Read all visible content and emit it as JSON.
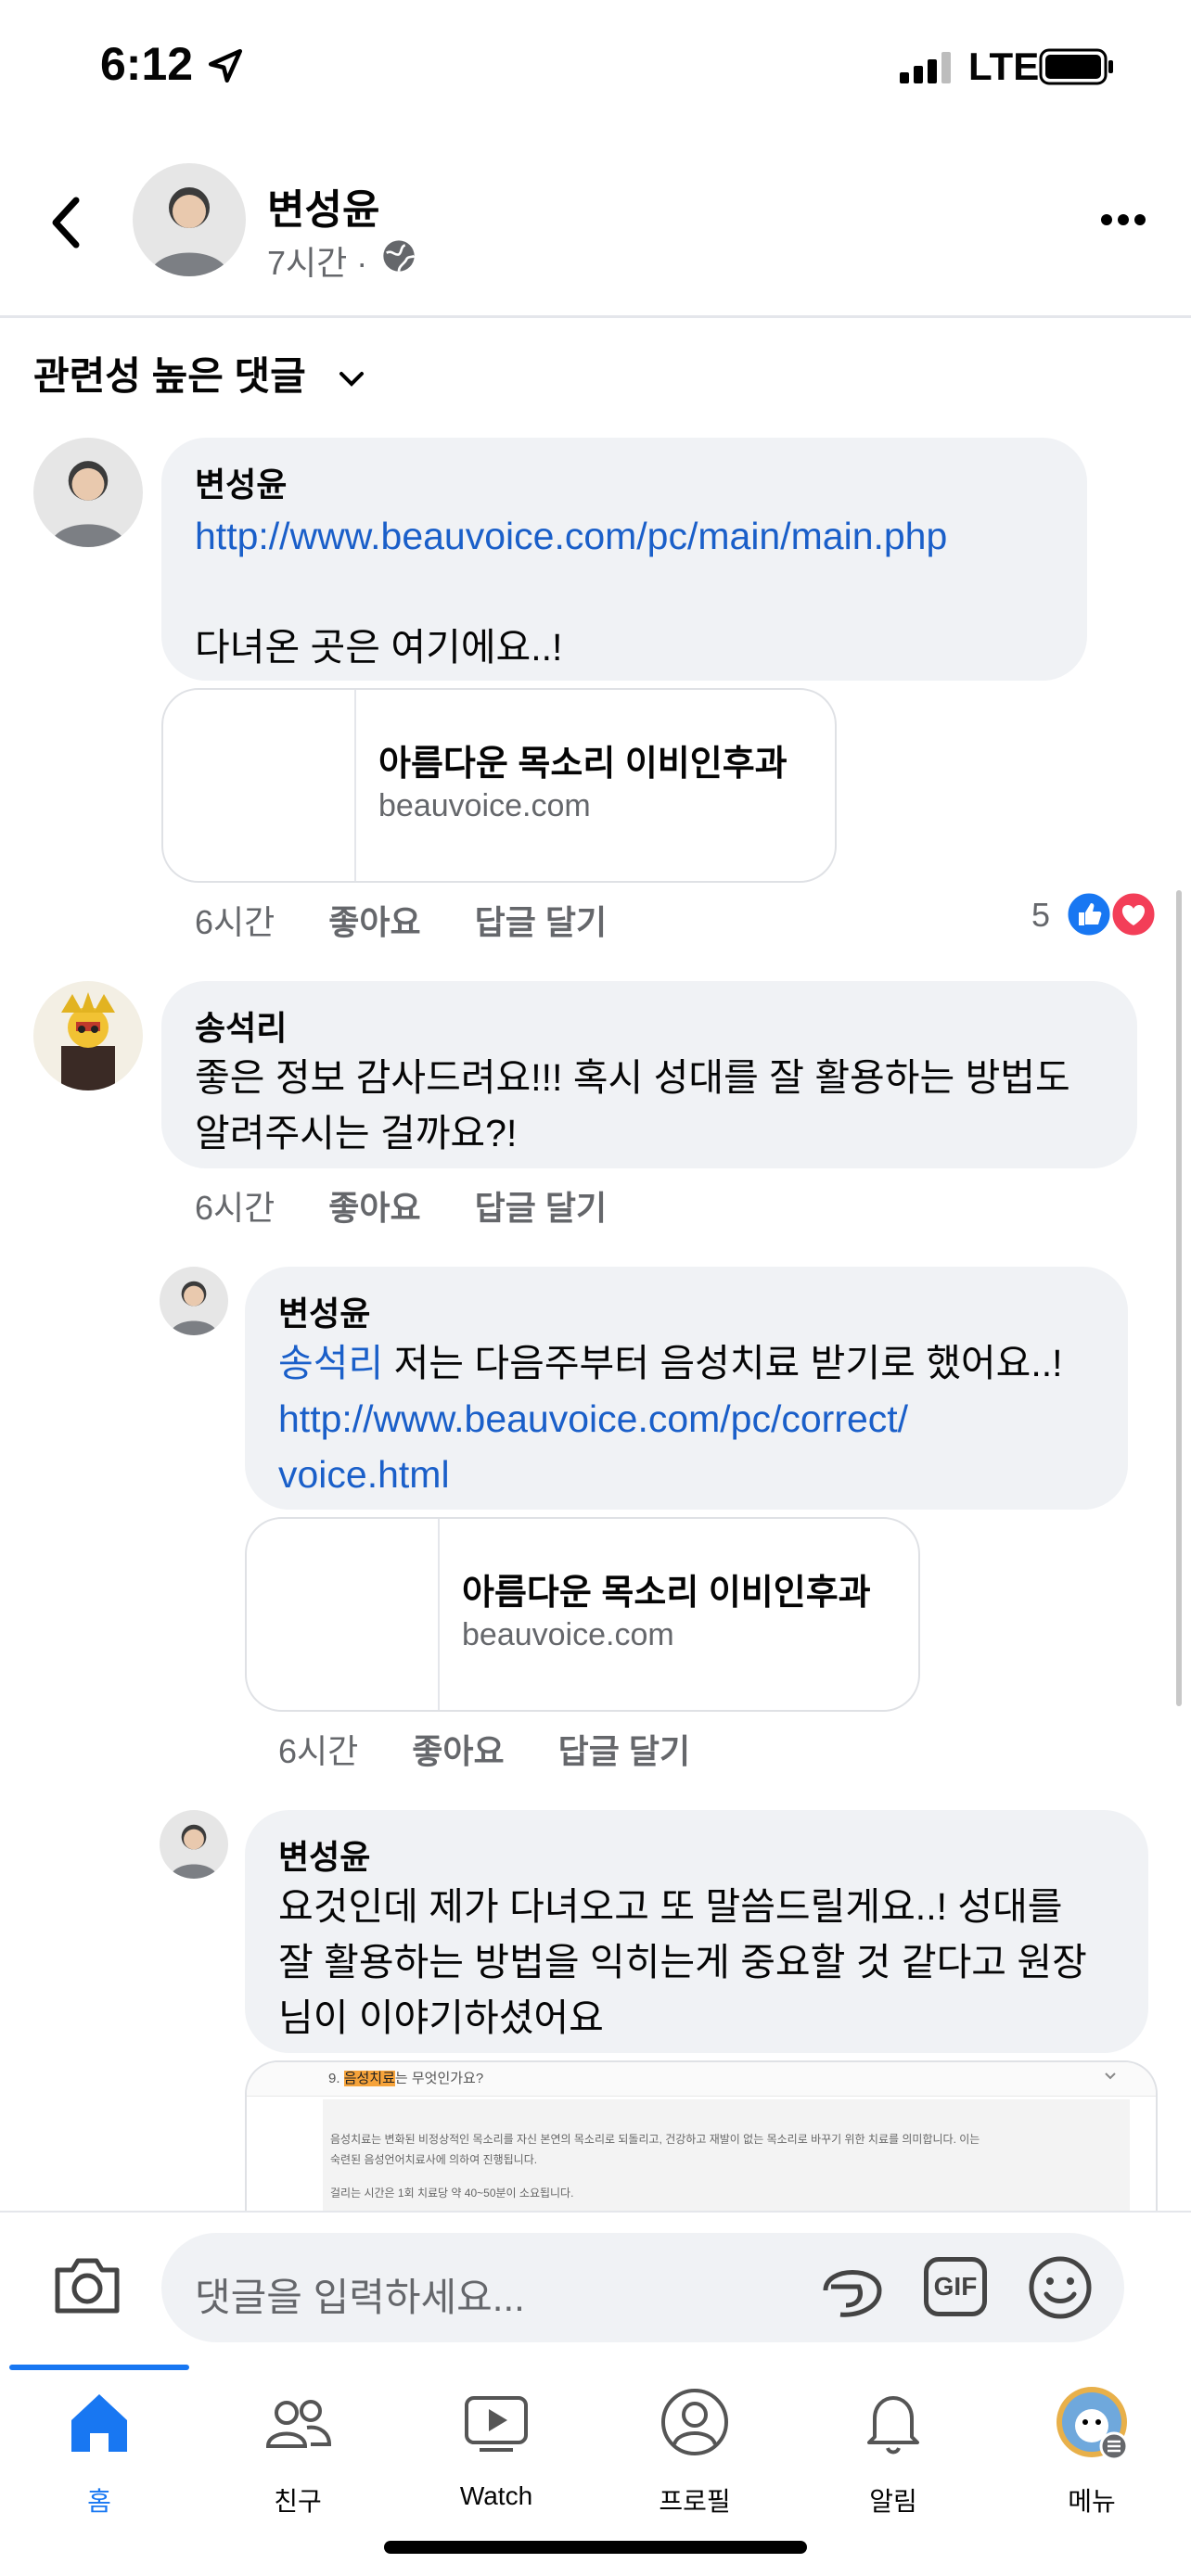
{
  "status_bar": {
    "time": "6:12",
    "network": "LTE"
  },
  "post_header": {
    "author": "변성윤",
    "time": "7시간",
    "separator": "·"
  },
  "sort": {
    "label": "관련성 높은 댓글"
  },
  "comments": [
    {
      "author": "변성윤",
      "link": "http://www.beauvoice.com/pc/main/main.php",
      "text": "다녀온 곳은 여기에요..!",
      "preview": {
        "title": "아름다운 목소리 이비인후과",
        "domain": "beauvoice.com"
      },
      "time": "6시간",
      "like": "좋아요",
      "reply": "답글 달기",
      "reactions_count": "5"
    },
    {
      "author": "송석리",
      "text_line1": "좋은 정보 감사드려요!!! 혹시 성대를 잘 활용하는 방법도",
      "text_line2": "알려주시는 걸까요?!",
      "time": "6시간",
      "like": "좋아요",
      "reply": "답글 달기"
    },
    {
      "author": "변성윤",
      "mention": "송석리",
      "text": " 저는 다음주부터 음성치료 받기로 했어요..!",
      "link_line1": "http://www.beauvoice.com/pc/correct/",
      "link_line2": "voice.html",
      "preview": {
        "title": "아름다운 목소리 이비인후과",
        "domain": "beauvoice.com"
      },
      "time": "6시간",
      "like": "좋아요",
      "reply": "답글 달기"
    },
    {
      "author": "변성윤",
      "text_line1": "요것인데 제가 다녀오고 또 말씀드릴게요..! 성대를",
      "text_line2": "잘 활용하는 방법을 익히는게 중요할 것 같다고 원장",
      "text_line3": "님이 이야기하셨어요",
      "image": {
        "heading_prefix": "9. ",
        "heading_highlight": "음성치료",
        "heading_suffix": "는 무엇인가요?",
        "body_line1": "음성치료는 변화된 비정상적인 목소리를 자신 본연의 목소리로 되돌리고, 건강하고 재발이 없는 목소리로 바꾸기 위한 치료를 의미합니다. 이는",
        "body_line2": "숙련된 음성언어치료사에 의하여 진행됩니다.",
        "body_line3": "걸리는 시간은 1회 치료당 약 40~50분이 소요됩니다."
      }
    }
  ],
  "composer": {
    "placeholder": "댓글을 입력하세요...",
    "gif": "GIF"
  },
  "tabs": [
    {
      "label": "홈",
      "icon": "home-icon"
    },
    {
      "label": "친구",
      "icon": "friends-icon"
    },
    {
      "label": "Watch",
      "icon": "watch-icon"
    },
    {
      "label": "프로필",
      "icon": "profile-icon"
    },
    {
      "label": "알림",
      "icon": "bell-icon"
    },
    {
      "label": "메뉴",
      "icon": "menu-icon"
    }
  ],
  "colors": {
    "accent": "#1877f2",
    "link": "#1a5fc9",
    "bubble": "#f0f2f5",
    "muted": "#65676b"
  }
}
